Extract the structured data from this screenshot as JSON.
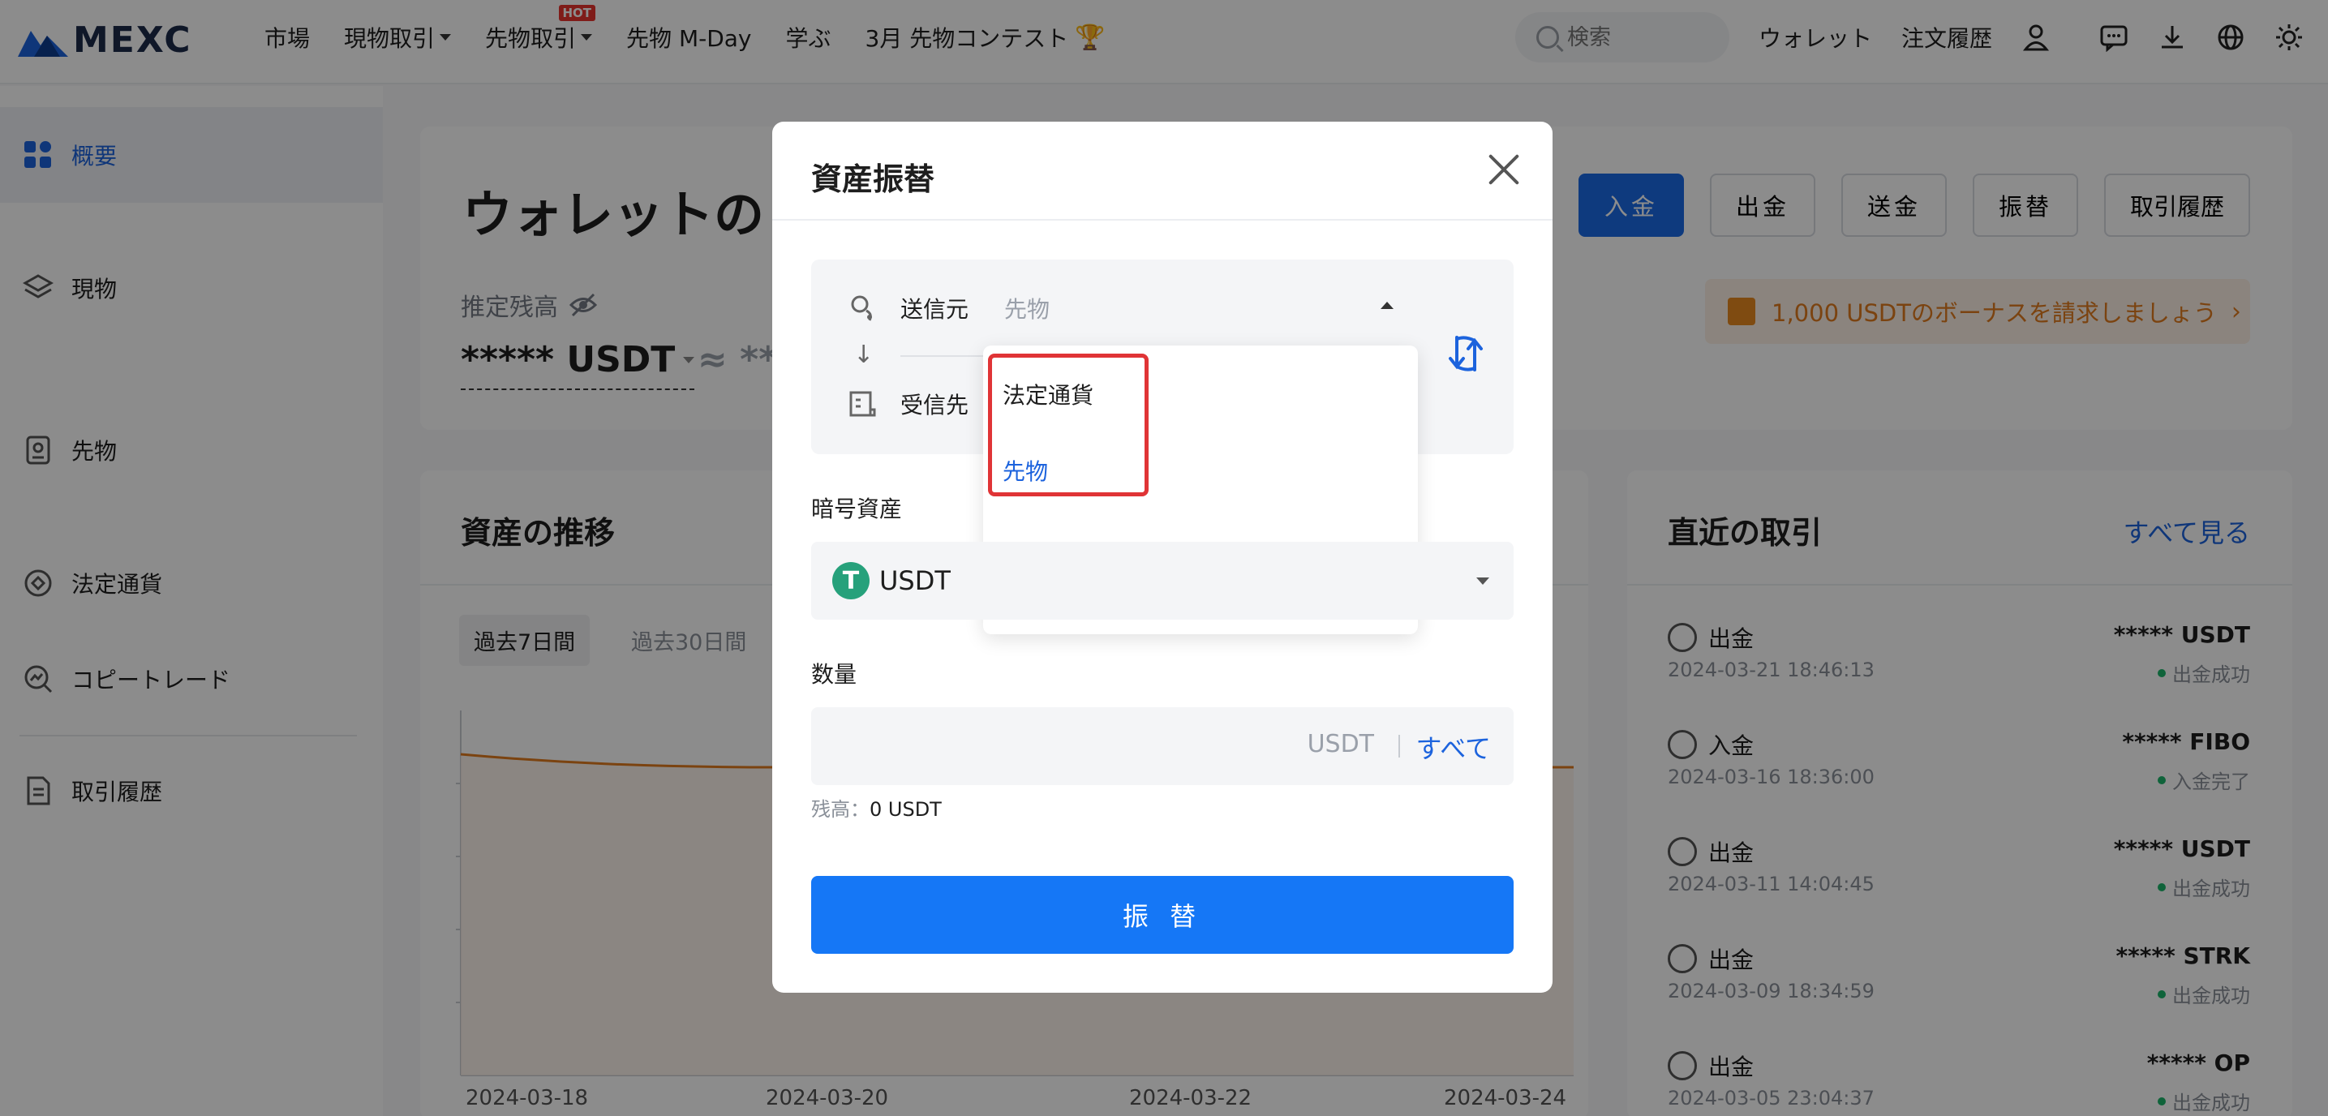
{
  "brand": {
    "name": "MEXC",
    "accent": "#1b6ae6",
    "logo_color": "#1c2a4a"
  },
  "nav": {
    "items": [
      {
        "label": "市場"
      },
      {
        "label": "現物取引"
      },
      {
        "label": "先物取引",
        "badge": "HOT"
      },
      {
        "label": "先物 M-Day"
      },
      {
        "label": "学ぶ"
      },
      {
        "label": "3月 先物コンテスト"
      }
    ],
    "search_placeholder": "検索",
    "wallet": "ウォレット",
    "orders": "注文履歴",
    "icons": [
      "user-icon",
      "chat-icon",
      "download-icon",
      "globe-icon",
      "theme-icon"
    ]
  },
  "sidebar": {
    "items": [
      {
        "label": "概要",
        "icon": "grid-icon",
        "active": true
      },
      {
        "label": "現物",
        "icon": "layers-icon"
      },
      {
        "label": "先物",
        "icon": "contract-icon"
      },
      {
        "label": "法定通貨",
        "icon": "coin-icon"
      },
      {
        "label": "コピートレード",
        "icon": "copytrade-icon"
      },
      {
        "label": "取引履歴",
        "icon": "document-icon"
      }
    ]
  },
  "overview": {
    "title": "ウォレットの",
    "estimated_label": "推定残高",
    "estimated_value": "***** USDT",
    "approx": "≈ ***",
    "actions": [
      "入金",
      "出金",
      "送金",
      "振替",
      "取引履歴"
    ],
    "bonus": "1,000 USDTのボーナスを請求しましょう"
  },
  "asset_trend": {
    "title": "資産の推移",
    "tabs": [
      "過去7日間",
      "過去30日間"
    ],
    "x_labels": [
      "2024-03-18",
      "2024-03-20",
      "2024-03-22",
      "2024-03-24"
    ]
  },
  "recent": {
    "title": "直近の取引",
    "see_all": "すべて見る",
    "items": [
      {
        "type": "出金",
        "time": "2024-03-21 18:46:13",
        "amount": "***** USDT",
        "status": "出金成功"
      },
      {
        "type": "入金",
        "time": "2024-03-16 18:36:00",
        "amount": "***** FIBO",
        "status": "入金完了"
      },
      {
        "type": "出金",
        "time": "2024-03-11 14:04:45",
        "amount": "***** USDT",
        "status": "出金成功"
      },
      {
        "type": "出金",
        "time": "2024-03-09 18:34:59",
        "amount": "***** STRK",
        "status": "出金成功"
      },
      {
        "type": "出金",
        "time": "2024-03-05 23:04:37",
        "amount": "***** OP",
        "status": "出金成功"
      }
    ]
  },
  "modal": {
    "title": "資産振替",
    "from_label": "送信元",
    "from_value": "先物",
    "to_label": "受信先",
    "dropdown": [
      {
        "label": "法定通貨"
      },
      {
        "label": "先物",
        "selected": true
      }
    ],
    "asset_label": "暗号資産",
    "asset_value": "USDT",
    "asset_logo": "T",
    "qty_label": "数量",
    "qty_unit": "USDT",
    "qty_all": "すべて",
    "balance_label": "残高：",
    "balance_value": "0 USDT",
    "submit": "振 替"
  }
}
